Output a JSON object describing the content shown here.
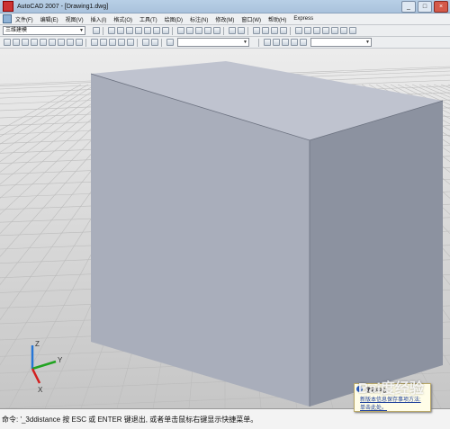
{
  "window": {
    "title": "AutoCAD 2007 - [Drawing1.dwg]",
    "buttons": [
      "_",
      "□",
      "×"
    ]
  },
  "menu": [
    "文件(F)",
    "编辑(E)",
    "视图(V)",
    "插入(I)",
    "格式(O)",
    "工具(T)",
    "绘图(D)",
    "标注(N)",
    "修改(M)",
    "窗口(W)",
    "帮助(H)",
    "Express"
  ],
  "workspace": {
    "value": "三维建模"
  },
  "command_line": "命令: '_3ddistance 按 ESC 或 ENTER 键退出, 或者单击鼠标右键显示快捷菜单。",
  "notification": {
    "title": "通讯中心",
    "line1": "新版本信息保存事项方法:",
    "line2": "单击此处。"
  },
  "watermark": "Bai度经验",
  "axes": {
    "x": "X",
    "y": "Y",
    "z": "Z"
  },
  "colors": {
    "box_front": "#a9aebb",
    "box_top": "#bfc3cf",
    "box_side": "#8c92a0",
    "axis_x": "#d21f1f",
    "axis_y": "#21a321",
    "axis_z": "#2676d6"
  }
}
